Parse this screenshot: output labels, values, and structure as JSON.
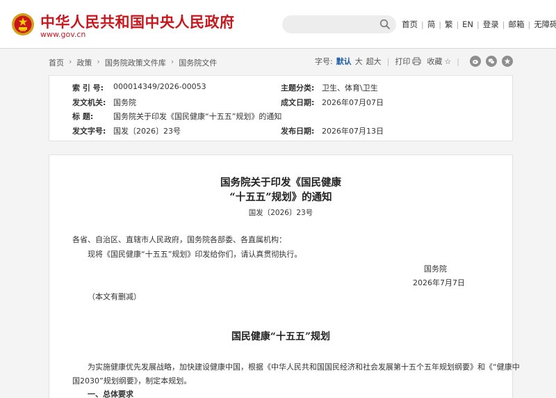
{
  "header": {
    "site_title": "中华人民共和国中央人民政府",
    "domain": "www.gov.cn",
    "search_placeholder": "",
    "links": [
      "首页",
      "简",
      "繁",
      "EN",
      "登录",
      "邮箱",
      "无障碍"
    ]
  },
  "breadcrumb": [
    "首页",
    "政策",
    "国务院政策文件库",
    "国务院文件"
  ],
  "tools": {
    "font_label": "字号:",
    "font_sizes": [
      "默认",
      "大",
      "超大"
    ],
    "print": "打印",
    "favorite": "收藏"
  },
  "info": {
    "index_label": "索 引 号:",
    "index_value": "000014349/2026-00053",
    "subject_label": "主题分类:",
    "subject_value": "卫生、体育\\卫生",
    "issuer_label": "发文机关:",
    "issuer_value": "国务院",
    "created_label": "成文日期:",
    "created_value": "2026年07月07日",
    "title_label": "标 题:",
    "title_value": "国务院关于印发《国民健康“十五五”规划》的通知",
    "docno_label": "发文字号:",
    "docno_value": "国发〔2026〕23号",
    "published_label": "发布日期:",
    "published_value": "2026年07月13日"
  },
  "article": {
    "title_line1": "国务院关于印发《国民健康",
    "title_line2": "“十五五”规划》的通知",
    "doc_no": "国发〔2026〕23号",
    "recipients": "各省、自治区、直辖市人民政府，国务院各部委、各直属机构：",
    "body": "现将《国民健康“十五五”规划》印发给你们，请认真贯彻执行。",
    "signer": "国务院",
    "date": "2026年7月7日",
    "note": "（本文有删减）",
    "plan_title": "国民健康“十五五”规划",
    "plan_para_line1": "为实施健康优先发展战略，加快建设健康中国，根据《中华人民共和国国民经济和社会发展第十五个五年规划纲要》和《“健康中",
    "plan_para_line2": "国2030”规划纲要》，制定本规划。",
    "section1": "一、总体要求"
  },
  "colors": {
    "brand_red": "#c8161d",
    "active_blue": "#1e5ea8"
  }
}
